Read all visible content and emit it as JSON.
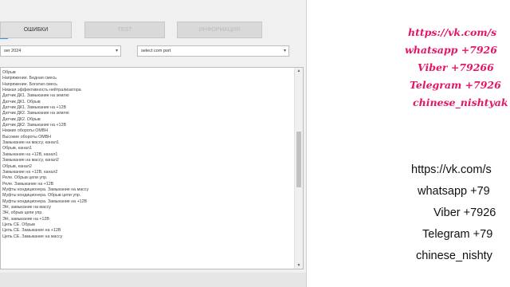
{
  "app": {
    "tabs": [
      "ОШИБКИ",
      "TEST",
      "ИНФОРМАЦИЯ"
    ],
    "model_select": "ser 2024",
    "port_select": "select com port",
    "log_lines": [
      "Обрыв",
      "Напряжение. Бедная смесь",
      "Напряжение. Богатая смесь",
      "Низкая эффективность нейтрализатора",
      "Датчик ДК1. Замыкание на землю",
      "Датчик ДК1. Обрыв",
      "Датчик ДК1. Замыкание на +12В",
      "Датчик ДК2. Замыкание на землю",
      "Датчик ДК2. Обрыв",
      "Датчик ДК2. Замыкание на +12В",
      "Низкие обороты ОМВН",
      "Высокие обороты ОМВН",
      "Замыкание на массу, канал1",
      "Обрыв, канал1",
      "Замыкание на +12В, канал1",
      "Замыкание на массу, канал2",
      "Обрыв, канал2",
      "Замыкание на +12В, канал2",
      "Реле. Обрыв цепи упр.",
      "Реле. Замыкание на +12В",
      "Муфты кондиционера. Замыкание на массу",
      "Муфты кондиционера. Обрыв цепи упр.",
      "Муфты кондиционера. Замыкание на +12В",
      "ЭН, замыкание на массу",
      "ЭН, обрыв цепи упр.",
      "ЭН, замыкание на +12В",
      "Цепь СЕ. Обрыв",
      "Цепь СЕ. Замыкание на +12В",
      "Цепь СЕ. Замыкание на массу"
    ]
  },
  "promo": {
    "lines": [
      "https://vk.com/s",
      "whatsapp +7926",
      "Viber +79266",
      "Telegram +7926",
      "chinese_nishtyak"
    ],
    "lines_plain": [
      "https://vk.com/s",
      "whatsapp +79",
      "Viber +7926",
      "Telegram +79",
      "chinese_nishty"
    ],
    "accent_color": "#e3146e"
  }
}
